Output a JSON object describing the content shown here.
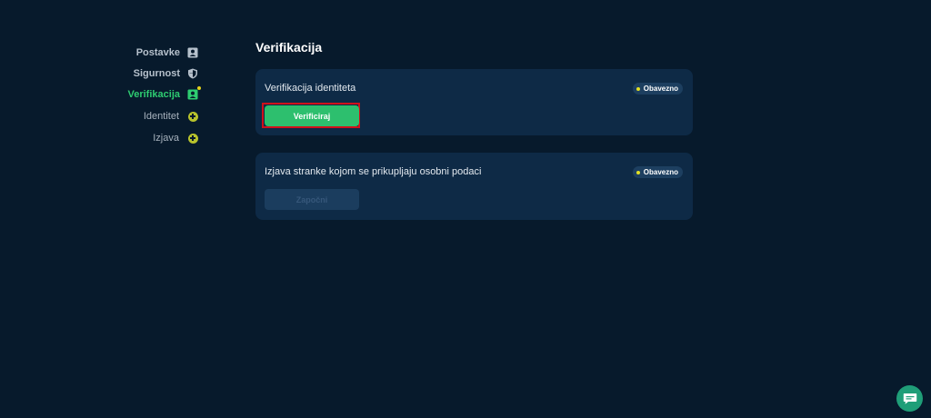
{
  "sidebar": {
    "items": [
      {
        "label": "Postavke",
        "icon": "person-card-icon"
      },
      {
        "label": "Sigurnost",
        "icon": "shield-icon"
      },
      {
        "label": "Verifikacija",
        "icon": "person-card-icon",
        "active": true,
        "notification": true
      },
      {
        "label": "Identitet",
        "icon": "plus-circle-icon"
      },
      {
        "label": "Izjava",
        "icon": "plus-circle-icon"
      }
    ]
  },
  "main": {
    "title": "Verifikacija",
    "cards": [
      {
        "title": "Verifikacija identiteta",
        "badge": "Obavezno",
        "button": "Verificiraj",
        "button_state": "enabled"
      },
      {
        "title": "Izjava stranke kojom se prikupljaju osobni podaci",
        "badge": "Obavezno",
        "button": "Započni",
        "button_state": "disabled"
      }
    ]
  },
  "colors": {
    "background": "#071a2c",
    "card": "#0e2a46",
    "accent": "#2dbf6e",
    "badge_dot": "#e3e023",
    "highlight": "#d0101b"
  },
  "chat": {
    "icon": "chat-bubble-icon"
  }
}
